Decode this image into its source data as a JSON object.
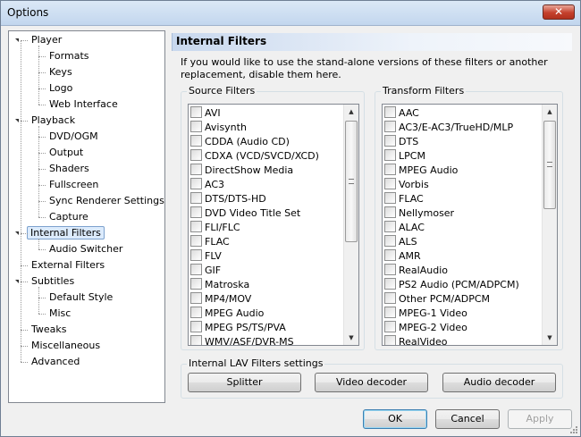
{
  "window": {
    "title": "Options"
  },
  "tree": {
    "nodes": [
      {
        "label": "Player",
        "level": 0,
        "expandable": true
      },
      {
        "label": "Formats",
        "level": 1
      },
      {
        "label": "Keys",
        "level": 1
      },
      {
        "label": "Logo",
        "level": 1
      },
      {
        "label": "Web Interface",
        "level": 1
      },
      {
        "label": "Playback",
        "level": 0,
        "expandable": true
      },
      {
        "label": "DVD/OGM",
        "level": 1
      },
      {
        "label": "Output",
        "level": 1
      },
      {
        "label": "Shaders",
        "level": 1
      },
      {
        "label": "Fullscreen",
        "level": 1
      },
      {
        "label": "Sync Renderer Settings",
        "level": 1
      },
      {
        "label": "Capture",
        "level": 1
      },
      {
        "label": "Internal Filters",
        "level": 0,
        "expandable": true,
        "selected": true
      },
      {
        "label": "Audio Switcher",
        "level": 1
      },
      {
        "label": "External Filters",
        "level": 0
      },
      {
        "label": "Subtitles",
        "level": 0,
        "expandable": true
      },
      {
        "label": "Default Style",
        "level": 1
      },
      {
        "label": "Misc",
        "level": 1
      },
      {
        "label": "Tweaks",
        "level": 0
      },
      {
        "label": "Miscellaneous",
        "level": 0
      },
      {
        "label": "Advanced",
        "level": 0
      }
    ]
  },
  "page": {
    "title": "Internal Filters",
    "description": "If you would like to use the stand-alone versions of these filters or another replacement, disable them here."
  },
  "source_filters": {
    "label": "Source Filters",
    "items": [
      "AVI",
      "Avisynth",
      "CDDA (Audio CD)",
      "CDXA (VCD/SVCD/XCD)",
      "DirectShow Media",
      "AC3",
      "DTS/DTS-HD",
      "DVD Video Title Set",
      "FLI/FLC",
      "FLAC",
      "FLV",
      "GIF",
      "Matroska",
      "MP4/MOV",
      "MPEG Audio",
      "MPEG PS/TS/PVA",
      "WMV/ASF/DVR-MS"
    ]
  },
  "transform_filters": {
    "label": "Transform Filters",
    "items": [
      "AAC",
      "AC3/E-AC3/TrueHD/MLP",
      "DTS",
      "LPCM",
      "MPEG Audio",
      "Vorbis",
      "FLAC",
      "Nellymoser",
      "ALAC",
      "ALS",
      "AMR",
      "RealAudio",
      "PS2 Audio (PCM/ADPCM)",
      "Other PCM/ADPCM",
      "MPEG-1 Video",
      "MPEG-2 Video",
      "RealVideo"
    ]
  },
  "lav": {
    "label": "Internal LAV Filters settings",
    "splitter": "Splitter",
    "video": "Video decoder",
    "audio": "Audio decoder"
  },
  "buttons": {
    "ok": "OK",
    "cancel": "Cancel",
    "apply": "Apply"
  },
  "colors": {
    "selection": "#dcebfc",
    "header_gradient": "#c8d8ee",
    "close": "#c5412d"
  }
}
